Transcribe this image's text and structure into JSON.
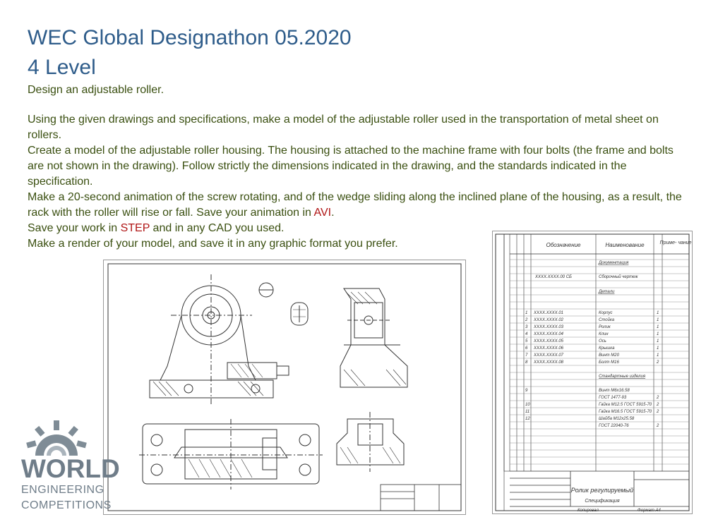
{
  "header": {
    "title": "WEC Global Designathon 05.2020",
    "level": "4 Level"
  },
  "task": {
    "intro": "Design an adjustable roller.",
    "p1": "Using the given drawings and specifications, make a model of the adjustable roller used in the transportation of metal sheet on rollers.",
    "p2": "Create a model of the adjustable roller housing. The housing is attached to the machine frame with four bolts (the frame and bolts are not shown in the drawing). Follow strictly the dimensions indicated in the drawing, and the standards indicated in the specification.",
    "p3_before": "Make a 20-second animation of the screw rotating, and of the wedge sliding along the inclined plane of the housing, as a result, the rack with the roller will rise or fall. Save your animation in ",
    "p3_highlight": "AVI",
    "p3_after": ".",
    "p4_before": "Save your work in ",
    "p4_highlight": "STEP",
    "p4_after": " and in any CAD you used.",
    "p5": "Make a render of your model, and save it in any graphic format you prefer."
  },
  "spec_sheet": {
    "header_col2": "Обозначение",
    "header_col3": "Наименование",
    "header_col4": "Приме-\nчание",
    "sections": {
      "docs": "Документация",
      "parts": "Детали",
      "standard": "Стандартные изделия"
    },
    "assembly_row": {
      "code": "XXXX.XXXX.00 СБ",
      "name": "Сборочный чертеж"
    },
    "parts": [
      {
        "pos": "1",
        "code": "XXXX.XXXX.01",
        "name": "Корпус",
        "qty": "1"
      },
      {
        "pos": "2",
        "code": "XXXX.XXXX.02",
        "name": "Стойка",
        "qty": "1"
      },
      {
        "pos": "3",
        "code": "XXXX.XXXX.03",
        "name": "Ролик",
        "qty": "1"
      },
      {
        "pos": "4",
        "code": "XXXX.XXXX.04",
        "name": "Клин",
        "qty": "1"
      },
      {
        "pos": "5",
        "code": "XXXX.XXXX.05",
        "name": "Ось",
        "qty": "1"
      },
      {
        "pos": "6",
        "code": "XXXX.XXXX.06",
        "name": "Крышка",
        "qty": "1"
      },
      {
        "pos": "7",
        "code": "XXXX.XXXX.07",
        "name": "Винт М20",
        "qty": "1"
      },
      {
        "pos": "8",
        "code": "XXXX.XXXX.08",
        "name": "Болт М16",
        "qty": "2"
      }
    ],
    "standard_items": [
      {
        "pos": "9",
        "name": "Винт М6х16.58",
        "qty": ""
      },
      {
        "pos": "",
        "name": "ГОСТ 1477-93",
        "qty": "2"
      },
      {
        "pos": "10",
        "name": "Гайка М12.5 ГОСТ 5915-70",
        "qty": "2"
      },
      {
        "pos": "11",
        "name": "Гайка М16.5 ГОСТ 5915-70",
        "qty": "2"
      },
      {
        "pos": "12",
        "name": "Шайба М12х25.58",
        "qty": ""
      },
      {
        "pos": "",
        "name": "ГОСТ 22040-76",
        "qty": "2"
      }
    ],
    "title_main": "Ролик регулируемый",
    "title_sub": "Спецификация",
    "footer_left": "Копировал",
    "footer_right": "Формат А4"
  },
  "logo": {
    "line1": "WORLD",
    "line2": "ENGINEERING",
    "line3": "COMPETITIONS",
    "color": "#6f7d89"
  },
  "colors": {
    "title": "#2e5c8a",
    "body": "#3a4f10",
    "highlight": "#b01515"
  }
}
